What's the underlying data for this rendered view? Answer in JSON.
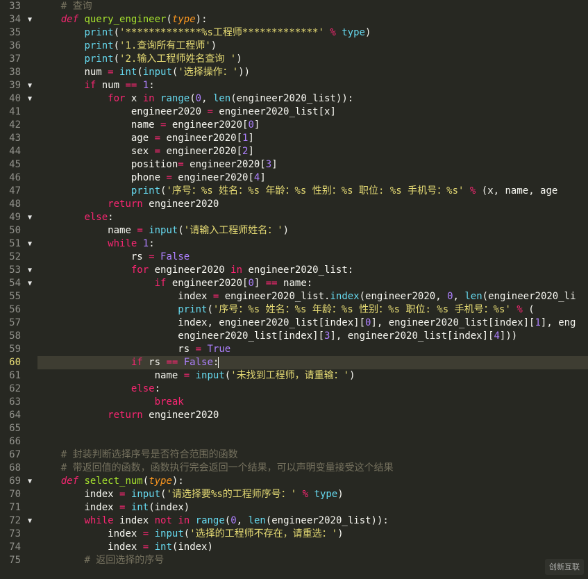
{
  "lines": [
    {
      "n": 33,
      "fold": "",
      "cls": "",
      "tokens": [
        [
          "    ",
          "id"
        ],
        [
          "# 查询",
          "cm"
        ]
      ]
    },
    {
      "n": 34,
      "fold": "▼",
      "cls": "",
      "tokens": [
        [
          "    ",
          "id"
        ],
        [
          "def",
          "kw"
        ],
        [
          " ",
          "id"
        ],
        [
          "query_engineer",
          "fn"
        ],
        [
          "(",
          "id"
        ],
        [
          "type",
          "pr"
        ],
        [
          ")",
          "id"
        ],
        [
          ":",
          "id"
        ]
      ]
    },
    {
      "n": 35,
      "fold": "",
      "cls": "",
      "tokens": [
        [
          "        ",
          "id"
        ],
        [
          "print",
          "bl"
        ],
        [
          "(",
          "id"
        ],
        [
          "'*************%s工程师*************'",
          "st"
        ],
        [
          " ",
          "id"
        ],
        [
          "%",
          "op"
        ],
        [
          " ",
          "id"
        ],
        [
          "type",
          "bl"
        ],
        [
          ")",
          "id"
        ]
      ]
    },
    {
      "n": 36,
      "fold": "",
      "cls": "",
      "tokens": [
        [
          "        ",
          "id"
        ],
        [
          "print",
          "bl"
        ],
        [
          "(",
          "id"
        ],
        [
          "'1.查询所有工程师'",
          "st"
        ],
        [
          ")",
          "id"
        ]
      ]
    },
    {
      "n": 37,
      "fold": "",
      "cls": "",
      "tokens": [
        [
          "        ",
          "id"
        ],
        [
          "print",
          "bl"
        ],
        [
          "(",
          "id"
        ],
        [
          "'2.输入工程师姓名查询 '",
          "st"
        ],
        [
          ")",
          "id"
        ]
      ]
    },
    {
      "n": 38,
      "fold": "",
      "cls": "",
      "tokens": [
        [
          "        ",
          "id"
        ],
        [
          "num ",
          "id"
        ],
        [
          "=",
          "op"
        ],
        [
          " ",
          "id"
        ],
        [
          "int",
          "bl"
        ],
        [
          "(",
          "id"
        ],
        [
          "input",
          "bl"
        ],
        [
          "(",
          "id"
        ],
        [
          "'选择操作：'",
          "st"
        ],
        [
          "))",
          "id"
        ]
      ]
    },
    {
      "n": 39,
      "fold": "▼",
      "cls": "",
      "tokens": [
        [
          "        ",
          "id"
        ],
        [
          "if",
          "kw2"
        ],
        [
          " num ",
          "id"
        ],
        [
          "==",
          "op"
        ],
        [
          " ",
          "id"
        ],
        [
          "1",
          "nm"
        ],
        [
          ":",
          "id"
        ]
      ]
    },
    {
      "n": 40,
      "fold": "▼",
      "cls": "",
      "tokens": [
        [
          "            ",
          "id"
        ],
        [
          "for",
          "kw2"
        ],
        [
          " x ",
          "id"
        ],
        [
          "in",
          "kw2"
        ],
        [
          " ",
          "id"
        ],
        [
          "range",
          "bl"
        ],
        [
          "(",
          "id"
        ],
        [
          "0",
          "nm"
        ],
        [
          ", ",
          "id"
        ],
        [
          "len",
          "bl"
        ],
        [
          "(engineer2020_list)):",
          "id"
        ]
      ]
    },
    {
      "n": 41,
      "fold": "",
      "cls": "",
      "tokens": [
        [
          "                ",
          "id"
        ],
        [
          "engineer2020 ",
          "id"
        ],
        [
          "=",
          "op"
        ],
        [
          " engineer2020_list[x]",
          "id"
        ]
      ]
    },
    {
      "n": 42,
      "fold": "",
      "cls": "",
      "tokens": [
        [
          "                ",
          "id"
        ],
        [
          "name ",
          "id"
        ],
        [
          "=",
          "op"
        ],
        [
          " engineer2020[",
          "id"
        ],
        [
          "0",
          "nm"
        ],
        [
          "]",
          "id"
        ]
      ]
    },
    {
      "n": 43,
      "fold": "",
      "cls": "",
      "tokens": [
        [
          "                ",
          "id"
        ],
        [
          "age ",
          "id"
        ],
        [
          "=",
          "op"
        ],
        [
          " engineer2020[",
          "id"
        ],
        [
          "1",
          "nm"
        ],
        [
          "]",
          "id"
        ]
      ]
    },
    {
      "n": 44,
      "fold": "",
      "cls": "",
      "tokens": [
        [
          "                ",
          "id"
        ],
        [
          "sex ",
          "id"
        ],
        [
          "=",
          "op"
        ],
        [
          " engineer2020[",
          "id"
        ],
        [
          "2",
          "nm"
        ],
        [
          "]",
          "id"
        ]
      ]
    },
    {
      "n": 45,
      "fold": "",
      "cls": "",
      "tokens": [
        [
          "                ",
          "id"
        ],
        [
          "position",
          "id"
        ],
        [
          "=",
          "op"
        ],
        [
          " engineer2020[",
          "id"
        ],
        [
          "3",
          "nm"
        ],
        [
          "]",
          "id"
        ]
      ]
    },
    {
      "n": 46,
      "fold": "",
      "cls": "",
      "tokens": [
        [
          "                ",
          "id"
        ],
        [
          "phone ",
          "id"
        ],
        [
          "=",
          "op"
        ],
        [
          " engineer2020[",
          "id"
        ],
        [
          "4",
          "nm"
        ],
        [
          "]",
          "id"
        ]
      ]
    },
    {
      "n": 47,
      "fold": "",
      "cls": "",
      "tokens": [
        [
          "                ",
          "id"
        ],
        [
          "print",
          "bl"
        ],
        [
          "(",
          "id"
        ],
        [
          "'序号：%s 姓名：%s 年龄：%s 性别：%s 职位: %s 手机号：%s'",
          "st"
        ],
        [
          " ",
          "id"
        ],
        [
          "%",
          "op"
        ],
        [
          " (x, name, age",
          "id"
        ]
      ]
    },
    {
      "n": 48,
      "fold": "",
      "cls": "",
      "tokens": [
        [
          "            ",
          "id"
        ],
        [
          "return",
          "kw2"
        ],
        [
          " engineer2020",
          "id"
        ]
      ]
    },
    {
      "n": 49,
      "fold": "▼",
      "cls": "",
      "tokens": [
        [
          "        ",
          "id"
        ],
        [
          "else",
          "kw2"
        ],
        [
          ":",
          "id"
        ]
      ]
    },
    {
      "n": 50,
      "fold": "",
      "cls": "",
      "tokens": [
        [
          "            ",
          "id"
        ],
        [
          "name ",
          "id"
        ],
        [
          "=",
          "op"
        ],
        [
          " ",
          "id"
        ],
        [
          "input",
          "bl"
        ],
        [
          "(",
          "id"
        ],
        [
          "'请输入工程师姓名：'",
          "st"
        ],
        [
          ")",
          "id"
        ]
      ]
    },
    {
      "n": 51,
      "fold": "▼",
      "cls": "",
      "tokens": [
        [
          "            ",
          "id"
        ],
        [
          "while",
          "kw2"
        ],
        [
          " ",
          "id"
        ],
        [
          "1",
          "nm"
        ],
        [
          ":",
          "id"
        ]
      ]
    },
    {
      "n": 52,
      "fold": "",
      "cls": "",
      "tokens": [
        [
          "                ",
          "id"
        ],
        [
          "rs ",
          "id"
        ],
        [
          "=",
          "op"
        ],
        [
          " ",
          "id"
        ],
        [
          "False",
          "cn"
        ]
      ]
    },
    {
      "n": 53,
      "fold": "▼",
      "cls": "",
      "tokens": [
        [
          "                ",
          "id"
        ],
        [
          "for",
          "kw2"
        ],
        [
          " engineer2020 ",
          "id"
        ],
        [
          "in",
          "kw2"
        ],
        [
          " engineer2020_list:",
          "id"
        ]
      ]
    },
    {
      "n": 54,
      "fold": "▼",
      "cls": "",
      "tokens": [
        [
          "                    ",
          "id"
        ],
        [
          "if",
          "kw2"
        ],
        [
          " engineer2020[",
          "id"
        ],
        [
          "0",
          "nm"
        ],
        [
          "] ",
          "id"
        ],
        [
          "==",
          "op"
        ],
        [
          " name:",
          "id"
        ]
      ]
    },
    {
      "n": 55,
      "fold": "",
      "cls": "",
      "tokens": [
        [
          "                        ",
          "id"
        ],
        [
          "index ",
          "id"
        ],
        [
          "=",
          "op"
        ],
        [
          " engineer2020_list.",
          "id"
        ],
        [
          "index",
          "bl"
        ],
        [
          "(engineer2020, ",
          "id"
        ],
        [
          "0",
          "nm"
        ],
        [
          ", ",
          "id"
        ],
        [
          "len",
          "bl"
        ],
        [
          "(engineer2020_li",
          "id"
        ]
      ]
    },
    {
      "n": 56,
      "fold": "",
      "cls": "",
      "tokens": [
        [
          "                        ",
          "id"
        ],
        [
          "print",
          "bl"
        ],
        [
          "(",
          "id"
        ],
        [
          "'序号：%s 姓名：%s 年龄：%s 性别：%s 职位: %s 手机号：%s'",
          "st"
        ],
        [
          " ",
          "id"
        ],
        [
          "%",
          "op"
        ],
        [
          " (",
          "id"
        ]
      ]
    },
    {
      "n": 57,
      "fold": "",
      "cls": "",
      "tokens": [
        [
          "                        ",
          "id"
        ],
        [
          "index, engineer2020_list[index][",
          "id"
        ],
        [
          "0",
          "nm"
        ],
        [
          "], engineer2020_list[index][",
          "id"
        ],
        [
          "1",
          "nm"
        ],
        [
          "], eng",
          "id"
        ]
      ]
    },
    {
      "n": 58,
      "fold": "",
      "cls": "",
      "tokens": [
        [
          "                        ",
          "id"
        ],
        [
          "engineer2020_list[index][",
          "id"
        ],
        [
          "3",
          "nm"
        ],
        [
          "], engineer2020_list[index][",
          "id"
        ],
        [
          "4",
          "nm"
        ],
        [
          "]))",
          "id"
        ]
      ]
    },
    {
      "n": 59,
      "fold": "",
      "cls": "",
      "tokens": [
        [
          "                        ",
          "id"
        ],
        [
          "rs ",
          "id"
        ],
        [
          "=",
          "op"
        ],
        [
          " ",
          "id"
        ],
        [
          "True",
          "cn"
        ]
      ]
    },
    {
      "n": 60,
      "fold": "",
      "cls": "hl",
      "tokens": [
        [
          "                ",
          "id"
        ],
        [
          "if",
          "kw2"
        ],
        [
          " rs ",
          "id"
        ],
        [
          "==",
          "op"
        ],
        [
          " ",
          "id"
        ],
        [
          "False",
          "cn"
        ],
        [
          ":",
          "id"
        ],
        [
          "|",
          "cursor"
        ]
      ]
    },
    {
      "n": 61,
      "fold": "",
      "cls": "",
      "tokens": [
        [
          "                    ",
          "id"
        ],
        [
          "name ",
          "id"
        ],
        [
          "=",
          "op"
        ],
        [
          " ",
          "id"
        ],
        [
          "input",
          "bl"
        ],
        [
          "(",
          "id"
        ],
        [
          "'未找到工程师，请重输：'",
          "st"
        ],
        [
          ")",
          "id"
        ]
      ]
    },
    {
      "n": 62,
      "fold": "",
      "cls": "",
      "tokens": [
        [
          "                ",
          "id"
        ],
        [
          "else",
          "kw2"
        ],
        [
          ":",
          "id"
        ]
      ]
    },
    {
      "n": 63,
      "fold": "",
      "cls": "",
      "tokens": [
        [
          "                    ",
          "id"
        ],
        [
          "break",
          "kw2"
        ]
      ]
    },
    {
      "n": 64,
      "fold": "",
      "cls": "",
      "tokens": [
        [
          "            ",
          "id"
        ],
        [
          "return",
          "kw2"
        ],
        [
          " engineer2020",
          "id"
        ]
      ]
    },
    {
      "n": 65,
      "fold": "",
      "cls": "",
      "tokens": [
        [
          "",
          "id"
        ]
      ]
    },
    {
      "n": 66,
      "fold": "",
      "cls": "",
      "tokens": [
        [
          "",
          "id"
        ]
      ]
    },
    {
      "n": 67,
      "fold": "",
      "cls": "",
      "tokens": [
        [
          "    ",
          "id"
        ],
        [
          "# 封装判断选择序号是否符合范围的函数",
          "cm"
        ]
      ]
    },
    {
      "n": 68,
      "fold": "",
      "cls": "",
      "tokens": [
        [
          "    ",
          "id"
        ],
        [
          "# 带返回值的函数，函数执行完会返回一个结果，可以声明变量接受这个结果",
          "cm"
        ]
      ]
    },
    {
      "n": 69,
      "fold": "▼",
      "cls": "",
      "tokens": [
        [
          "    ",
          "id"
        ],
        [
          "def",
          "kw"
        ],
        [
          " ",
          "id"
        ],
        [
          "select_num",
          "fn"
        ],
        [
          "(",
          "id"
        ],
        [
          "type",
          "pr"
        ],
        [
          ")",
          "id"
        ],
        [
          ":",
          "id"
        ]
      ]
    },
    {
      "n": 70,
      "fold": "",
      "cls": "",
      "tokens": [
        [
          "        ",
          "id"
        ],
        [
          "index ",
          "id"
        ],
        [
          "=",
          "op"
        ],
        [
          " ",
          "id"
        ],
        [
          "input",
          "bl"
        ],
        [
          "(",
          "id"
        ],
        [
          "'请选择要%s的工程师序号：'",
          "st"
        ],
        [
          " ",
          "id"
        ],
        [
          "%",
          "op"
        ],
        [
          " ",
          "id"
        ],
        [
          "type",
          "bl"
        ],
        [
          ")",
          "id"
        ]
      ]
    },
    {
      "n": 71,
      "fold": "",
      "cls": "",
      "tokens": [
        [
          "        ",
          "id"
        ],
        [
          "index ",
          "id"
        ],
        [
          "=",
          "op"
        ],
        [
          " ",
          "id"
        ],
        [
          "int",
          "bl"
        ],
        [
          "(index)",
          "id"
        ]
      ]
    },
    {
      "n": 72,
      "fold": "▼",
      "cls": "",
      "tokens": [
        [
          "        ",
          "id"
        ],
        [
          "while",
          "kw2"
        ],
        [
          " index ",
          "id"
        ],
        [
          "not",
          "kw2"
        ],
        [
          " ",
          "id"
        ],
        [
          "in",
          "kw2"
        ],
        [
          " ",
          "id"
        ],
        [
          "range",
          "bl"
        ],
        [
          "(",
          "id"
        ],
        [
          "0",
          "nm"
        ],
        [
          ", ",
          "id"
        ],
        [
          "len",
          "bl"
        ],
        [
          "(engineer2020_list)):",
          "id"
        ]
      ]
    },
    {
      "n": 73,
      "fold": "",
      "cls": "",
      "tokens": [
        [
          "            ",
          "id"
        ],
        [
          "index ",
          "id"
        ],
        [
          "=",
          "op"
        ],
        [
          " ",
          "id"
        ],
        [
          "input",
          "bl"
        ],
        [
          "(",
          "id"
        ],
        [
          "'选择的工程师不存在，请重选：'",
          "st"
        ],
        [
          ")",
          "id"
        ]
      ]
    },
    {
      "n": 74,
      "fold": "",
      "cls": "",
      "tokens": [
        [
          "            ",
          "id"
        ],
        [
          "index ",
          "id"
        ],
        [
          "=",
          "op"
        ],
        [
          " ",
          "id"
        ],
        [
          "int",
          "bl"
        ],
        [
          "(index)",
          "id"
        ]
      ]
    },
    {
      "n": 75,
      "fold": "",
      "cls": "",
      "tokens": [
        [
          "        ",
          "id"
        ],
        [
          "# 返回选择的序号",
          "cm"
        ]
      ]
    }
  ],
  "watermark": "创新互联"
}
